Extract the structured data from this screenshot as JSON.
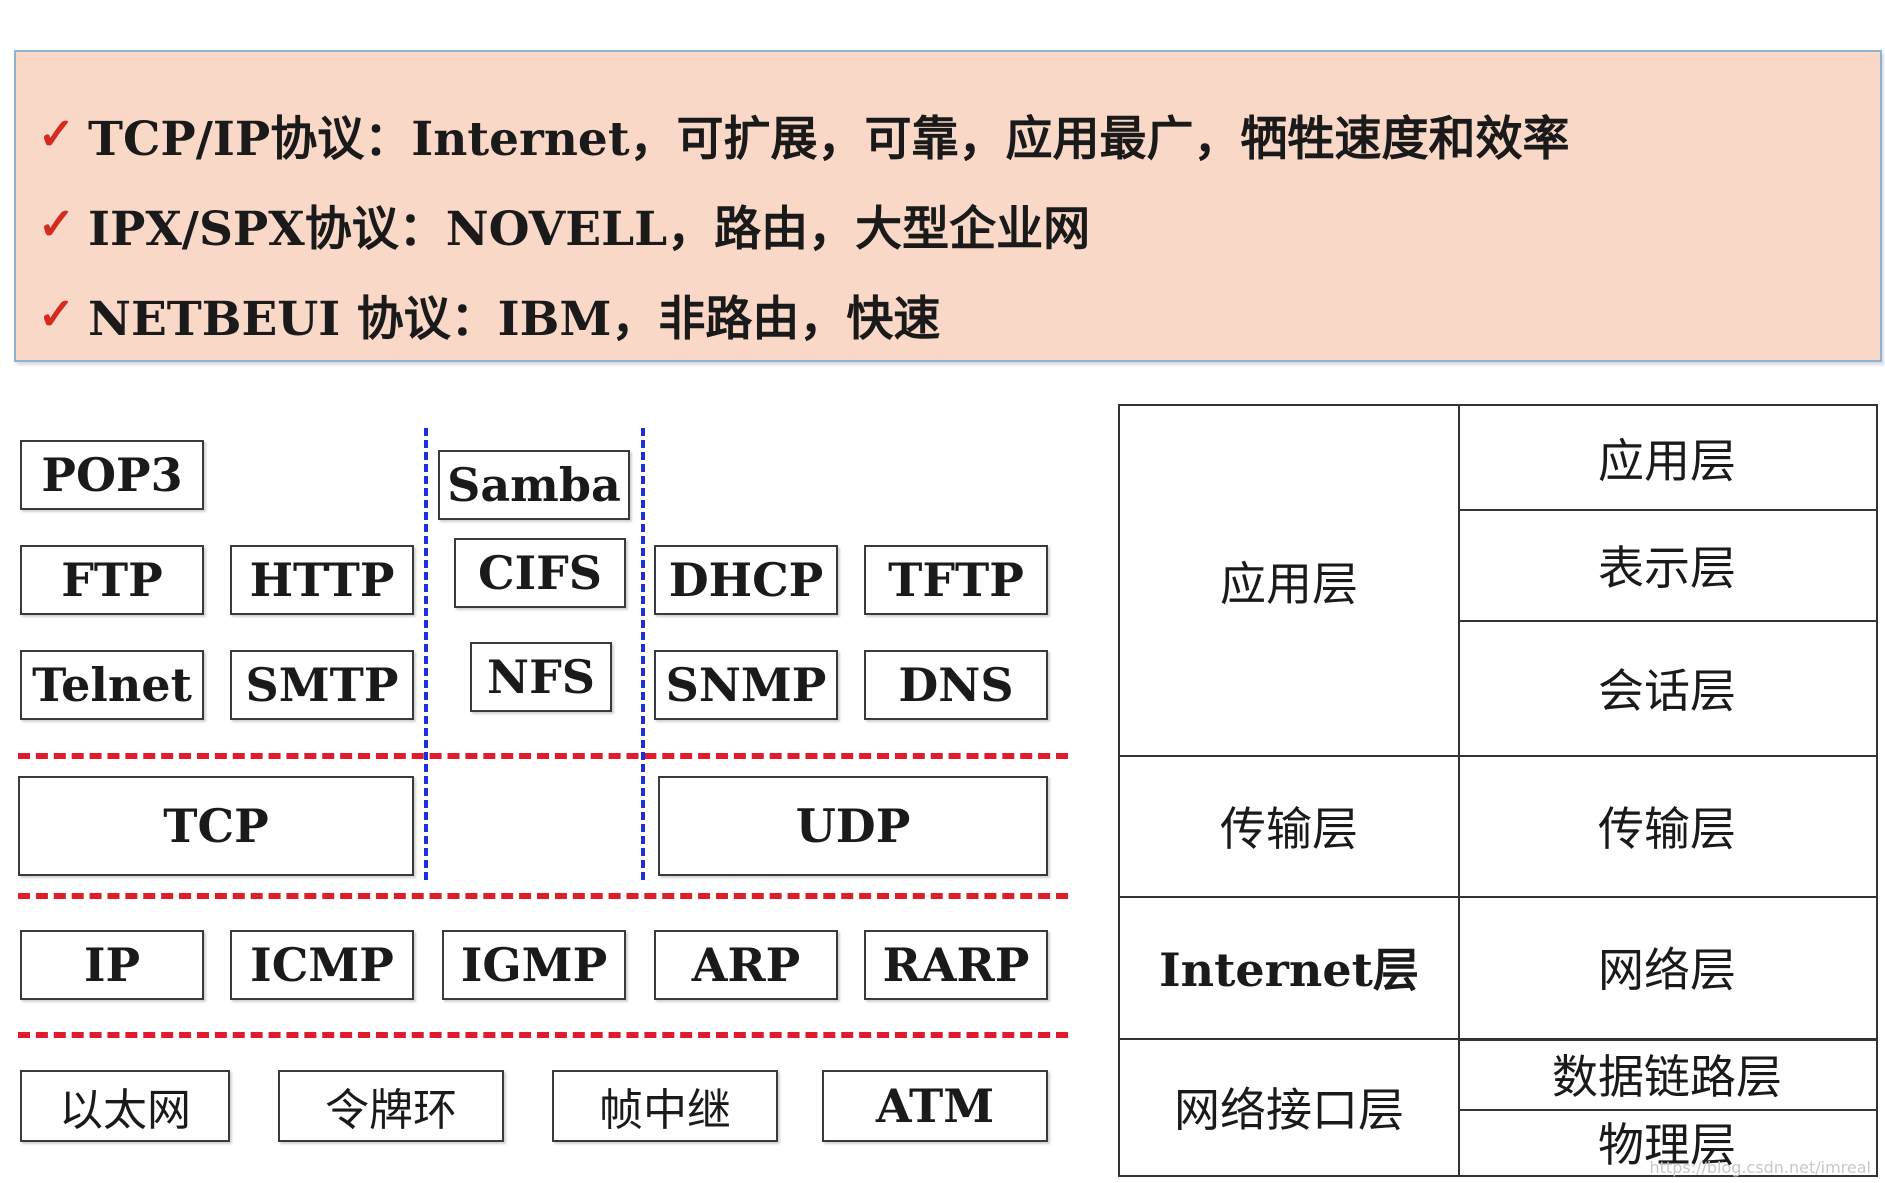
{
  "bullets": [
    {
      "check": "✓",
      "text": "TCP/IP协议：Internet，可扩展，可靠，应用最广，牺牲速度和效率"
    },
    {
      "check": "✓",
      "text": "IPX/SPX协议：NOVELL，路由，大型企业网"
    },
    {
      "check": "✓",
      "text": "NETBEUI 协议：IBM，非路由，快速"
    }
  ],
  "protocols": {
    "app_left": [
      "POP3",
      "FTP",
      "HTTP",
      "Telnet",
      "SMTP"
    ],
    "app_mid": [
      "Samba",
      "CIFS",
      "NFS"
    ],
    "app_right": [
      "DHCP",
      "TFTP",
      "SNMP",
      "DNS"
    ],
    "transport": [
      "TCP",
      "UDP"
    ],
    "network": [
      "IP",
      "ICMP",
      "IGMP",
      "ARP",
      "RARP"
    ],
    "link": [
      "以太网",
      "令牌环",
      "帧中继",
      "ATM"
    ]
  },
  "tcpip_layers": [
    "应用层",
    "传输层",
    "Internet层",
    "网络接口层"
  ],
  "osi_layers": [
    "应用层",
    "表示层",
    "会话层",
    "传输层",
    "网络层",
    "数据链路层",
    "物理层"
  ],
  "watermark": "https://blog.csdn.net/imreal"
}
